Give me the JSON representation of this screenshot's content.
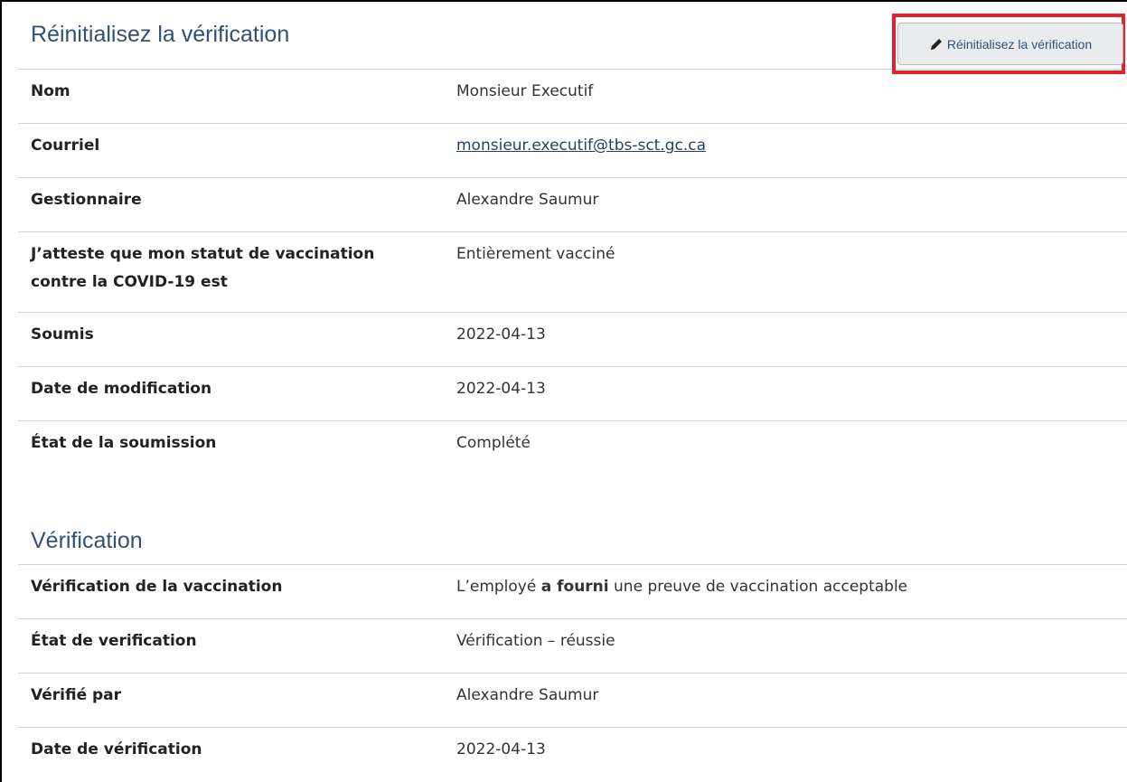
{
  "section1": {
    "title": "Réinitialisez la vérification",
    "reset_button_label": "Réinitialisez la vérification",
    "rows": [
      {
        "label": "Nom",
        "value": "Monsieur Executif"
      },
      {
        "label": "Courriel",
        "value": "monsieur.executif@tbs-sct.gc.ca"
      },
      {
        "label": "Gestionnaire",
        "value": "Alexandre Saumur"
      },
      {
        "label": "J’atteste que mon statut de vaccination contre la COVID-19 est",
        "value": "Entièrement vacciné"
      },
      {
        "label": "Soumis",
        "value": "2022-04-13"
      },
      {
        "label": "Date de modification",
        "value": "2022-04-13"
      },
      {
        "label": "État de la soumission",
        "value": "Complété"
      }
    ]
  },
  "section2": {
    "title": "Vérification",
    "rows": [
      {
        "label": "Vérification de la vaccination",
        "value_pre": "L’employé ",
        "value_bold": "a fourni",
        "value_post": " une preuve de vaccination acceptable"
      },
      {
        "label": "État de verification",
        "value": "Vérification – réussie"
      },
      {
        "label": "Vérifié par",
        "value": "Alexandre Saumur"
      },
      {
        "label": "Date de vérification",
        "value": "2022-04-13"
      }
    ]
  },
  "colors": {
    "heading": "#335075",
    "highlight": "#e3202b",
    "link": "#284162"
  },
  "icons": {
    "reset_button": "pencil-icon"
  }
}
